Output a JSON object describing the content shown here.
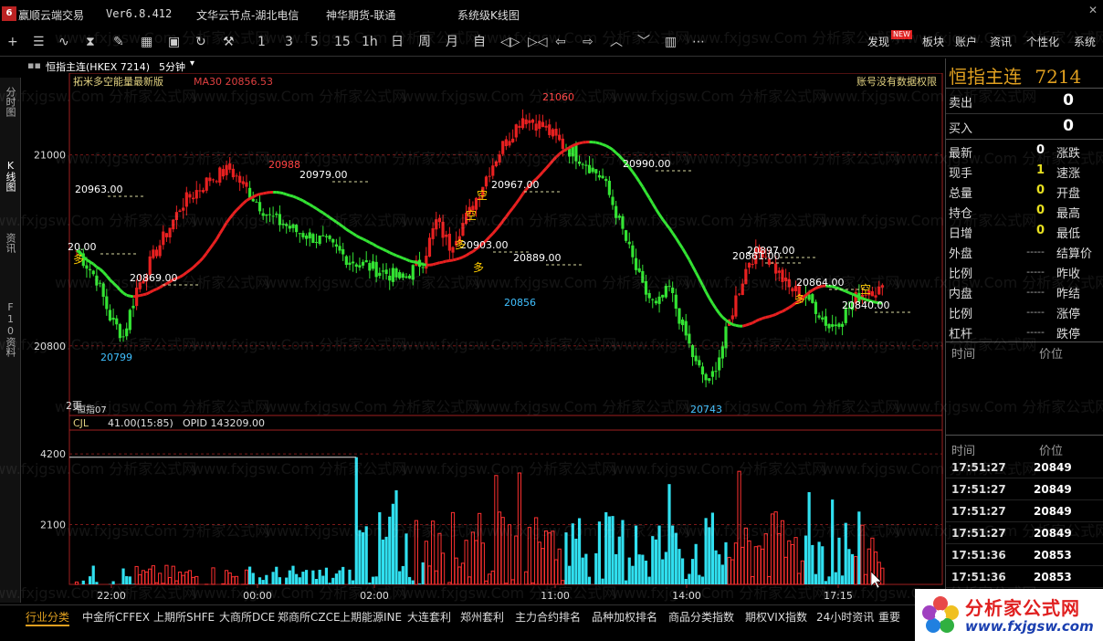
{
  "titlebar": {
    "app_name": "赢顺云端交易",
    "version": "Ver6.8.412",
    "node": "文华云节点-湖北电信",
    "futures": "神华期货-联通",
    "system": "系统级K线图"
  },
  "toolbar": {
    "period_labels": [
      "1",
      "3",
      "5",
      "15",
      "1h",
      "日",
      "周",
      "月",
      "自"
    ],
    "menu": [
      "发现",
      "板块",
      "账户",
      "资讯",
      "个性化",
      "系统"
    ],
    "new_badge": "NEW"
  },
  "lefttabs": [
    "分时图",
    "K线图",
    "资讯",
    "F10资料"
  ],
  "chart_header": {
    "symbol": "恒指主连(HKEX 7214)",
    "period": "5分钟",
    "indicator": "拓米多空能量最新版",
    "ma_label": "MA30 20856.53",
    "permission": "账号没有数据权限"
  },
  "volume_header": {
    "indicator": "CJL",
    "value": "41.00(15:85)",
    "opid": "OPID 143209.00"
  },
  "chart_data": {
    "type": "candlestick",
    "price_axis": {
      "ticks": [
        21000,
        20800
      ],
      "range": [
        20730,
        21080
      ]
    },
    "volume_axis": {
      "ticks": [
        4200,
        2100
      ]
    },
    "time_labels": [
      "22:00",
      "00:00",
      "02:00",
      "11:00",
      "14:00",
      "17:15"
    ],
    "annotations": {
      "high_label": "21060",
      "low_label": "20743",
      "marks": [
        "20963.00",
        "20988",
        "20979.00",
        "20869.00",
        "20799",
        "20967.00",
        "20903.00",
        "20889.00",
        "20856",
        "20990.00",
        "20897.00",
        "20861.00",
        "20864.00",
        "20840.00",
        "20.00"
      ],
      "signals": [
        "多",
        "空",
        "空",
        "多",
        "多",
        "多",
        "空"
      ],
      "cut_label": "2更",
      "contract_label": "恒指07"
    }
  },
  "rightpanel": {
    "title": "恒指主连",
    "code": "7214",
    "sell_label": "卖出",
    "sell_value": "0",
    "buy_label": "买入",
    "buy_value": "0",
    "rows": [
      {
        "l": "最新",
        "v": "0",
        "l2": "涨跌"
      },
      {
        "l": "现手",
        "v": "1",
        "l2": "速涨"
      },
      {
        "l": "总量",
        "v": "0",
        "l2": "开盘"
      },
      {
        "l": "持仓",
        "v": "0",
        "l2": "最高"
      },
      {
        "l": "日增",
        "v": "0",
        "l2": "最低"
      },
      {
        "l": "外盘",
        "v": "-----",
        "l2": "结算价"
      },
      {
        "l": "比例",
        "v": "-----",
        "l2": "昨收"
      },
      {
        "l": "内盘",
        "v": "-----",
        "l2": "昨结"
      },
      {
        "l": "比例",
        "v": "-----",
        "l2": "涨停"
      },
      {
        "l": "杠杆",
        "v": "-----",
        "l2": "跌停"
      }
    ],
    "head_time": "时间",
    "head_price": "价位",
    "ticks": [
      {
        "t": "17:51:27",
        "p": "20849"
      },
      {
        "t": "17:51:27",
        "p": "20849"
      },
      {
        "t": "17:51:27",
        "p": "20849"
      },
      {
        "t": "17:51:27",
        "p": "20849"
      },
      {
        "t": "17:51:36",
        "p": "20853"
      },
      {
        "t": "17:51:36",
        "p": "20853"
      }
    ]
  },
  "bottombar": [
    "行业分类",
    "中金所CFFEX",
    "上期所SHFE",
    "大商所DCE",
    "郑商所CZCE",
    "上期能源INE",
    "大连套利",
    "郑州套利",
    "主力合约排名",
    "品种加权排名",
    "商品分类指数",
    "期权VIX指数",
    "24小时资讯",
    "重要"
  ],
  "brand": {
    "cn": "分析家公式网",
    "url": "www.fxjgsw.com"
  },
  "watermark_text": "www.fxjgsw.Com 分析家公式网",
  "colors": {
    "up": "#e82020",
    "down": "#33e333",
    "accent": "#e0a020",
    "volume_up": "#ff3030",
    "volume_down": "#30e0f0"
  }
}
